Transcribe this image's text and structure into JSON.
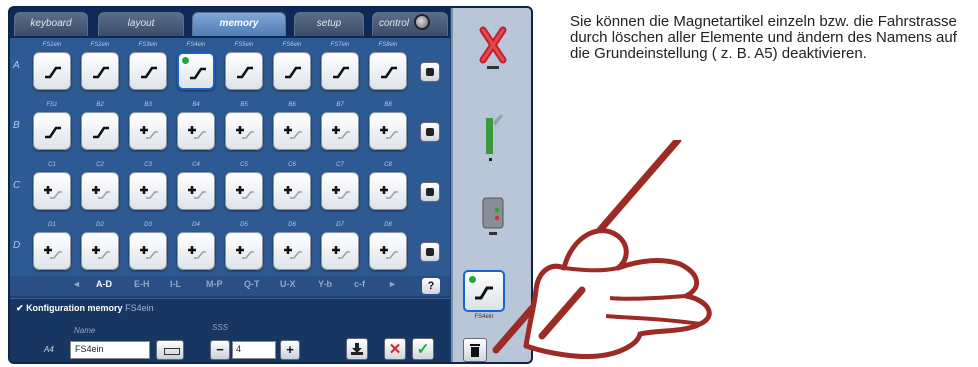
{
  "tabs": [
    {
      "label": "keyboard",
      "active": false
    },
    {
      "label": "layout",
      "active": false
    },
    {
      "label": "memory",
      "active": true
    },
    {
      "label": "setup",
      "active": false
    },
    {
      "label": "control",
      "active": false
    }
  ],
  "grid": {
    "rows": [
      {
        "letter": "A",
        "cells": [
          {
            "label": "FS1ein",
            "symbol": "route"
          },
          {
            "label": "FS2ein",
            "symbol": "route"
          },
          {
            "label": "FS3ein",
            "symbol": "route"
          },
          {
            "label": "FS4ein",
            "symbol": "route",
            "selected": true
          },
          {
            "label": "FS5ein",
            "symbol": "route"
          },
          {
            "label": "FS6ein",
            "symbol": "route"
          },
          {
            "label": "FS7ein",
            "symbol": "route"
          },
          {
            "label": "FS8ein",
            "symbol": "route"
          }
        ]
      },
      {
        "letter": "B",
        "cells": [
          {
            "label": "FS1",
            "symbol": "route"
          },
          {
            "label": "B2",
            "symbol": "route"
          },
          {
            "label": "B3",
            "symbol": "plus"
          },
          {
            "label": "B4",
            "symbol": "plus"
          },
          {
            "label": "B5",
            "symbol": "plus"
          },
          {
            "label": "B6",
            "symbol": "plus"
          },
          {
            "label": "B7",
            "symbol": "plus"
          },
          {
            "label": "B8",
            "symbol": "plus"
          }
        ]
      },
      {
        "letter": "C",
        "cells": [
          {
            "label": "C1",
            "symbol": "plus"
          },
          {
            "label": "C2",
            "symbol": "plus"
          },
          {
            "label": "C3",
            "symbol": "plus"
          },
          {
            "label": "C4",
            "symbol": "plus"
          },
          {
            "label": "C5",
            "symbol": "plus"
          },
          {
            "label": "C6",
            "symbol": "plus"
          },
          {
            "label": "C7",
            "symbol": "plus"
          },
          {
            "label": "C8",
            "symbol": "plus"
          }
        ]
      },
      {
        "letter": "D",
        "cells": [
          {
            "label": "D1",
            "symbol": "plus"
          },
          {
            "label": "D2",
            "symbol": "plus"
          },
          {
            "label": "D3",
            "symbol": "plus"
          },
          {
            "label": "D4",
            "symbol": "plus"
          },
          {
            "label": "D5",
            "symbol": "plus"
          },
          {
            "label": "D6",
            "symbol": "plus"
          },
          {
            "label": "D7",
            "symbol": "plus"
          },
          {
            "label": "D8",
            "symbol": "plus"
          }
        ]
      }
    ]
  },
  "pager": {
    "items": [
      "◄",
      "A-D",
      "E-H",
      "I-L",
      "M-P",
      "Q-T",
      "U-X",
      "Y-b",
      "c-f",
      "►"
    ],
    "active": "A-D",
    "help": "?"
  },
  "config": {
    "title": "Konfiguration memory",
    "title_item": "FS4ein",
    "name_label": "Name",
    "sss_label": "SSS",
    "slot": "A4",
    "name_value": "FS4ein",
    "sss_value": "4",
    "minus": "−",
    "plus": "+",
    "cancel": "✕",
    "ok": "✓"
  },
  "side": {
    "selected_label": "FS4ein"
  },
  "caption": {
    "text": "Sie können die Magnetartikel einzeln bzw. die Fahrstrasse durch löschen aller Elemente und ändern des Namens auf die Grundeinstellung ( z. B. A5) deaktivieren."
  },
  "colors": {
    "panel": "#1f3f73",
    "grid": "#2e5a93",
    "accent": "#1a63c8",
    "green": "#1ea73a",
    "red": "#d8232a",
    "pen": "#9c2b25"
  }
}
